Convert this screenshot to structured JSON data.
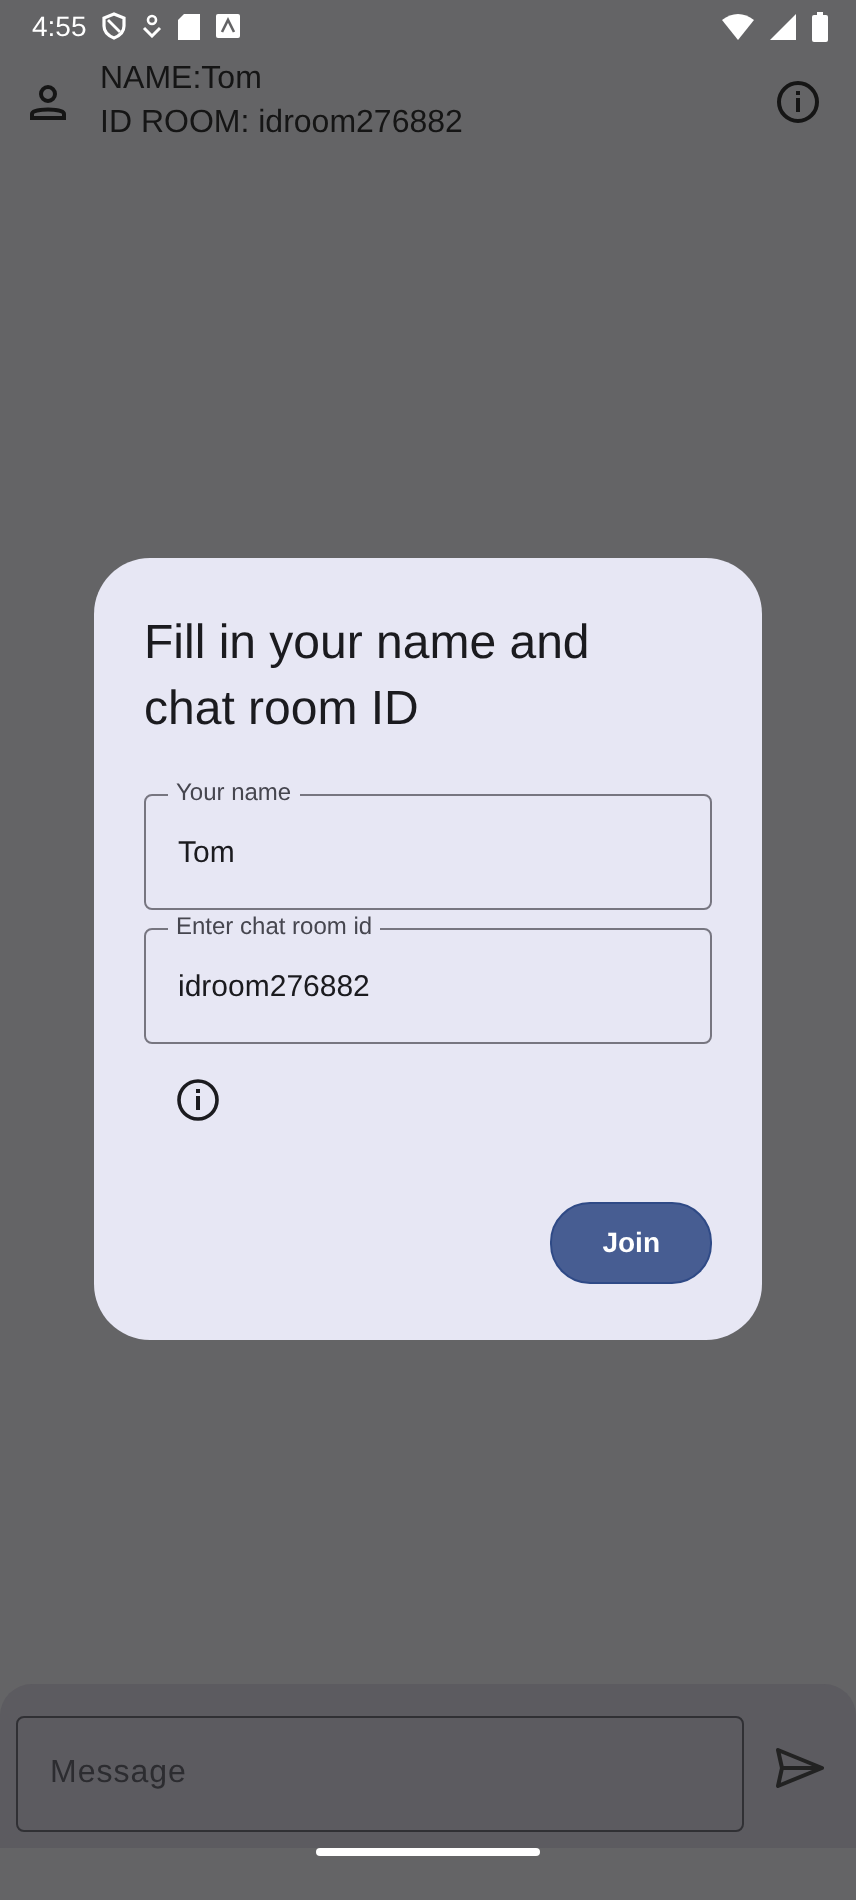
{
  "status_bar": {
    "time": "4:55"
  },
  "header": {
    "name": "NAME:Tom",
    "room": "ID ROOM: idroom276882"
  },
  "dialog": {
    "title": "Fill in your name and chat room ID",
    "fields": [
      {
        "label": "Your name",
        "value": "Tom"
      },
      {
        "label": "Enter chat room id",
        "value": "idroom276882"
      }
    ],
    "button": "Join"
  },
  "composer": {
    "placeholder": "Message"
  }
}
